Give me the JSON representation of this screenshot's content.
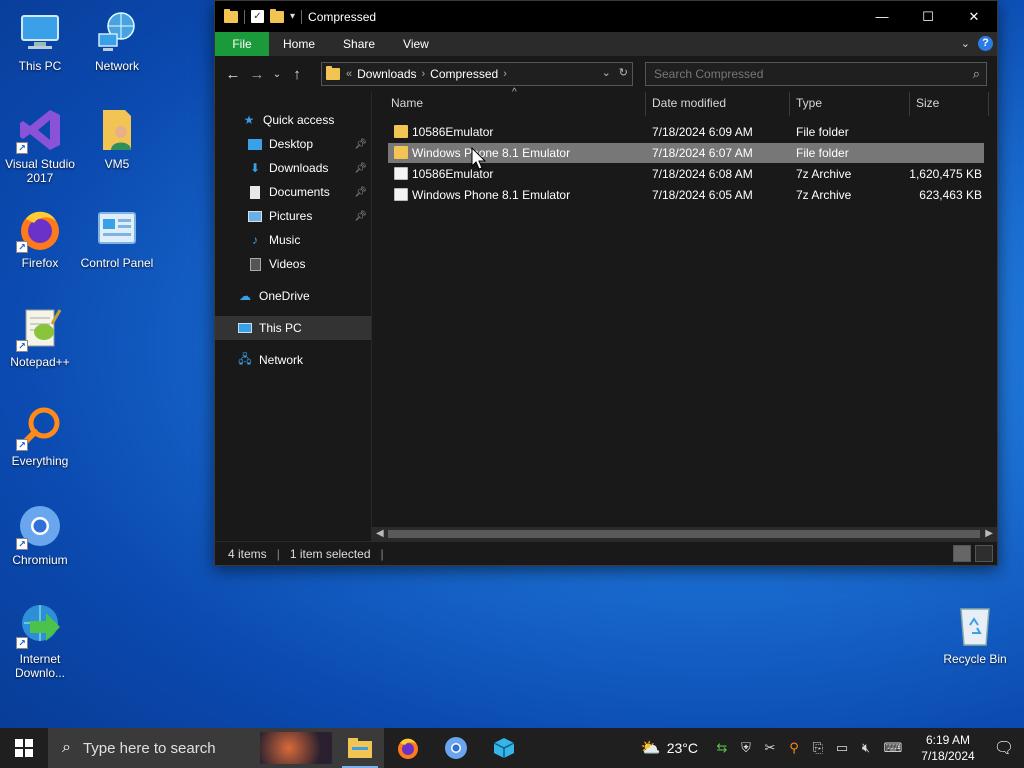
{
  "desktop": {
    "icons": [
      {
        "label": "This PC",
        "icon": "this-pc-icon"
      },
      {
        "label": "Network",
        "icon": "network-icon"
      },
      {
        "label": "Visual Studio 2017",
        "icon": "visual-studio-icon"
      },
      {
        "label": "VM5",
        "icon": "user-folder-icon"
      },
      {
        "label": "Firefox",
        "icon": "firefox-icon"
      },
      {
        "label": "Control Panel",
        "icon": "control-panel-icon"
      },
      {
        "label": "Notepad++",
        "icon": "notepadpp-icon"
      },
      {
        "label": "Everything",
        "icon": "everything-search-icon"
      },
      {
        "label": "Chromium",
        "icon": "chromium-icon"
      },
      {
        "label": "Internet Downlo...",
        "icon": "internet-download-manager-icon"
      },
      {
        "label": "Recycle Bin",
        "icon": "recycle-bin-icon"
      }
    ]
  },
  "window": {
    "title": "Compressed",
    "ribbon_tabs": [
      "File",
      "Home",
      "Share",
      "View"
    ],
    "help_label": "?",
    "address": {
      "overflow": "«",
      "crumbs": [
        "Downloads",
        "Compressed"
      ]
    },
    "search": {
      "placeholder": "Search Compressed"
    },
    "nav": {
      "quick_access": "Quick access",
      "items": [
        {
          "label": "Desktop",
          "pinned": true
        },
        {
          "label": "Downloads",
          "pinned": true
        },
        {
          "label": "Documents",
          "pinned": true
        },
        {
          "label": "Pictures",
          "pinned": true
        },
        {
          "label": "Music",
          "pinned": false
        },
        {
          "label": "Videos",
          "pinned": false
        }
      ],
      "onedrive": "OneDrive",
      "this_pc": "This PC",
      "network": "Network"
    },
    "columns": [
      "Name",
      "Date modified",
      "Type",
      "Size"
    ],
    "files": [
      {
        "name": "10586Emulator",
        "date": "7/18/2024 6:09 AM",
        "type": "File folder",
        "size": ""
      },
      {
        "name": "Windows Phone 8.1 Emulator",
        "date": "7/18/2024 6:07 AM",
        "type": "File folder",
        "size": ""
      },
      {
        "name": "10586Emulator",
        "date": "7/18/2024 6:08 AM",
        "type": "7z Archive",
        "size": "1,620,475 KB"
      },
      {
        "name": "Windows Phone 8.1 Emulator",
        "date": "7/18/2024 6:05 AM",
        "type": "7z Archive",
        "size": "623,463 KB"
      }
    ],
    "status": {
      "items": "4 items",
      "selected": "1 item selected"
    }
  },
  "taskbar": {
    "search_placeholder": "Type here to search",
    "weather": "23°C",
    "time": "6:19 AM",
    "date": "7/18/2024"
  }
}
